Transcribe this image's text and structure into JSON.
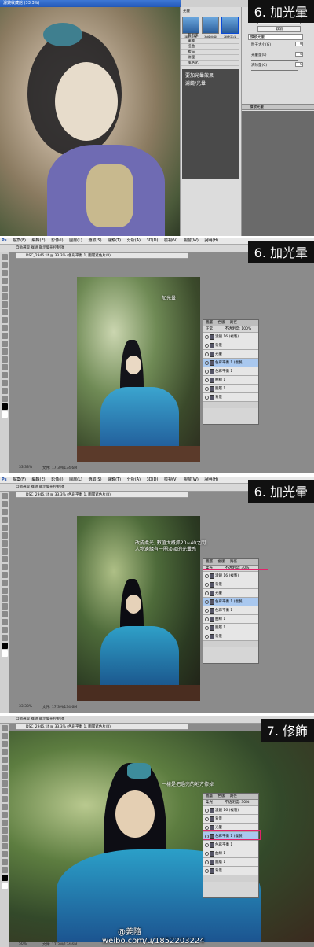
{
  "panels": {
    "p1": {
      "step": "6. 加光暈",
      "window_title": "濾鏡收藏館 (33.3%)",
      "gallery": {
        "folder": "光暈",
        "thumbs": [
          "漫射光暈",
          "海綿效果",
          "邊緣亮化"
        ],
        "list": [
          "藝術風",
          "筆觸",
          "扭曲",
          "素描",
          "紋理",
          "風格化"
        ],
        "description": "要加光暈效果\n濾鏡/光暈"
      },
      "settings": {
        "ok": "確定",
        "cancel": "取消",
        "filter": "擴散光暈",
        "fields": [
          {
            "label": "粒子大小(G)",
            "value": "0"
          },
          {
            "label": "光暈量(L)",
            "value": "4"
          },
          {
            "label": "清除量(C)",
            "value": "6"
          }
        ],
        "bottom_label": "擴散光暈"
      }
    },
    "p2": {
      "step": "6. 加光暈",
      "menu": [
        "檔案(F)",
        "編輯(E)",
        "影像(I)",
        "圖層(L)",
        "選取(S)",
        "濾鏡(T)",
        "分析(A)",
        "3D(D)",
        "檢視(V)",
        "視窗(W)",
        "說明(H)"
      ],
      "options": "自動選取 群組   顯示變形控制項",
      "doc_tab": "DSC_2946.tif @ 33.3% (色彩平衡 1, 圖層遮色片/8)",
      "caption": "加光暈",
      "status": "33.33%",
      "status_doc": "文件: 17.3M/134.6M",
      "layers": {
        "tabs": [
          "圖層",
          "色版",
          "路徑"
        ],
        "blend": "正常",
        "opacity": "不透明度: 100%",
        "rows": [
          "濾鏡 16 (複製)",
          "背景",
          "光暈",
          "色彩平衡 1 (複製)",
          "色彩平衡 1",
          "曲線 1",
          "圖層 1",
          "背景"
        ],
        "selected": 3
      }
    },
    "p3": {
      "step": "6. 加光暈",
      "caption": "改成柔光, 數值大概抓20~40之間,\n人物邊緣有一圈淡淡的光暈感",
      "status": "33.33%",
      "status_doc": "文件: 17.3M/134.6M",
      "layers": {
        "blend": "柔光",
        "opacity": "不透明度: 30%",
        "rows": [
          "濾鏡 16 (複製)",
          "背景",
          "光暈",
          "色彩平衡 1 (複製)",
          "色彩平衡 1",
          "曲線 1",
          "圖層 1",
          "背景"
        ],
        "selected": 3
      }
    },
    "p4": {
      "step": "7. 修飾",
      "caption": "一樣是把過亮的地方修掉",
      "status": "50%",
      "status_doc": "文件: 17.3M/134.6M",
      "layers": {
        "blend": "柔光",
        "opacity": "不透明度: 30%",
        "rows": [
          "濾鏡 16 (複製)",
          "背景",
          "光暈",
          "色彩平衡 1 (複製)",
          "色彩平衡 1",
          "曲線 1",
          "圖層 1",
          "背景"
        ],
        "selected": 3
      },
      "watermark_name": "@姜隨",
      "watermark_url": "weibo.com/u/1852203224"
    }
  },
  "colors": {
    "highlight": "#e0236a",
    "photoshop_bg": "#8b8b8b",
    "selected_layer": "#a9c8ef"
  }
}
